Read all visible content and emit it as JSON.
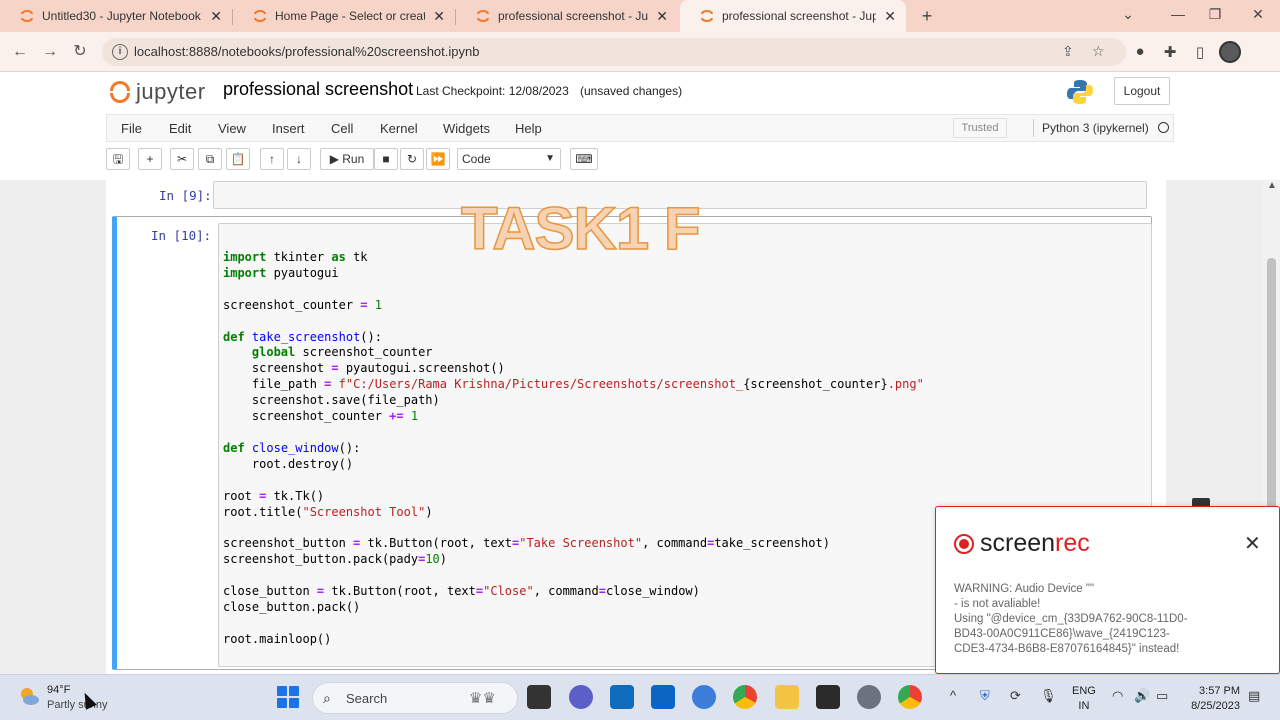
{
  "browser": {
    "tabs": [
      {
        "title": "Untitled30 - Jupyter Notebook",
        "close": "✕"
      },
      {
        "title": "Home Page - Select or create a n",
        "close": "✕"
      },
      {
        "title": "professional screenshot - Jupyte",
        "close": "✕"
      },
      {
        "title": "professional screenshot - Jupyte",
        "close": "✕"
      }
    ],
    "new_tab": "+",
    "window_controls": {
      "minimize": "⌄",
      "restore": "❐",
      "close": "✕"
    },
    "url": "localhost:8888/notebooks/professional%20screenshot.ipynb"
  },
  "jupyter": {
    "logo_text": "jupyter",
    "notebook_name": "professional screenshot",
    "checkpoint": "Last Checkpoint: 12/08/2023",
    "unsaved": "(unsaved changes)",
    "logout": "Logout",
    "menu": [
      "File",
      "Edit",
      "View",
      "Insert",
      "Cell",
      "Kernel",
      "Widgets",
      "Help"
    ],
    "trusted": "Trusted",
    "kernel": "Python 3 (ipykernel)",
    "toolbar": {
      "run_label": "Run",
      "cell_type": "Code"
    }
  },
  "cells": {
    "cell9_prompt": "In [9]:",
    "cell10_prompt": "In [10]:"
  },
  "overlay_text": "TASK1 F",
  "screenrec": {
    "brand_a": "screen",
    "brand_b": "rec",
    "close": "✕",
    "warning_lines": [
      "WARNING: Audio Device \"\"",
      "- is not avaliable!",
      "Using \"@device_cm_{33D9A762-90C8-11D0-",
      "BD43-00A0C911CE86}\\wave_{2419C123-",
      "CDE3-4734-B6B8-E87076164845}\" instead!"
    ]
  },
  "taskbar": {
    "weather_temp": "94°F",
    "weather_desc": "Partly sunny",
    "search_label": "Search",
    "language_top": "ENG",
    "language_bottom": "IN",
    "time": "3:57 PM",
    "date": "8/25/2023"
  },
  "colors": {
    "accent_blue": "#42a5f5",
    "jupyter_orange": "#f37726",
    "screenrec_red": "#dd2222",
    "tabstrip": "#f6d5c8"
  }
}
